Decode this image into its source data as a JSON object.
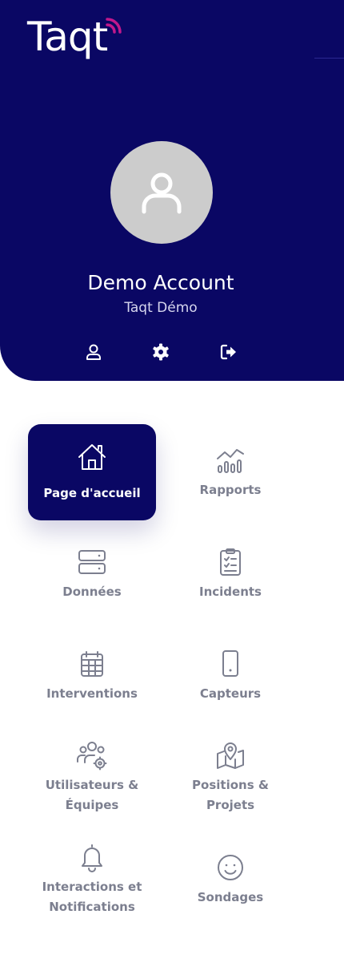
{
  "app": {
    "logo_text": "Taqt"
  },
  "profile": {
    "name": "Demo Account",
    "organization": "Taqt Démo"
  },
  "header_icons": [
    {
      "name": "user-icon"
    },
    {
      "name": "gear-icon"
    },
    {
      "name": "logout-icon"
    }
  ],
  "menu": [
    {
      "label": "Page d'accueil",
      "icon": "home-icon",
      "active": true
    },
    {
      "label": "Rapports",
      "icon": "chart-icon",
      "active": false
    },
    {
      "label": "Données",
      "icon": "database-icon",
      "active": false
    },
    {
      "label": "Incidents",
      "icon": "clipboard-icon",
      "active": false
    },
    {
      "label": "Interventions",
      "icon": "calendar-icon",
      "active": false
    },
    {
      "label": "Capteurs",
      "icon": "device-icon",
      "active": false
    },
    {
      "label": "Utilisateurs & Équipes",
      "icon": "users-gear-icon",
      "active": false
    },
    {
      "label": "Positions & Projets",
      "icon": "map-pin-icon",
      "active": false
    },
    {
      "label": "Interactions et Notifications",
      "icon": "bell-icon",
      "active": false
    },
    {
      "label": "Sondages",
      "icon": "smiley-icon",
      "active": false
    }
  ],
  "colors": {
    "primary": "#0a0764",
    "accent": "#c2188c",
    "muted_text": "#7c7f8f"
  }
}
